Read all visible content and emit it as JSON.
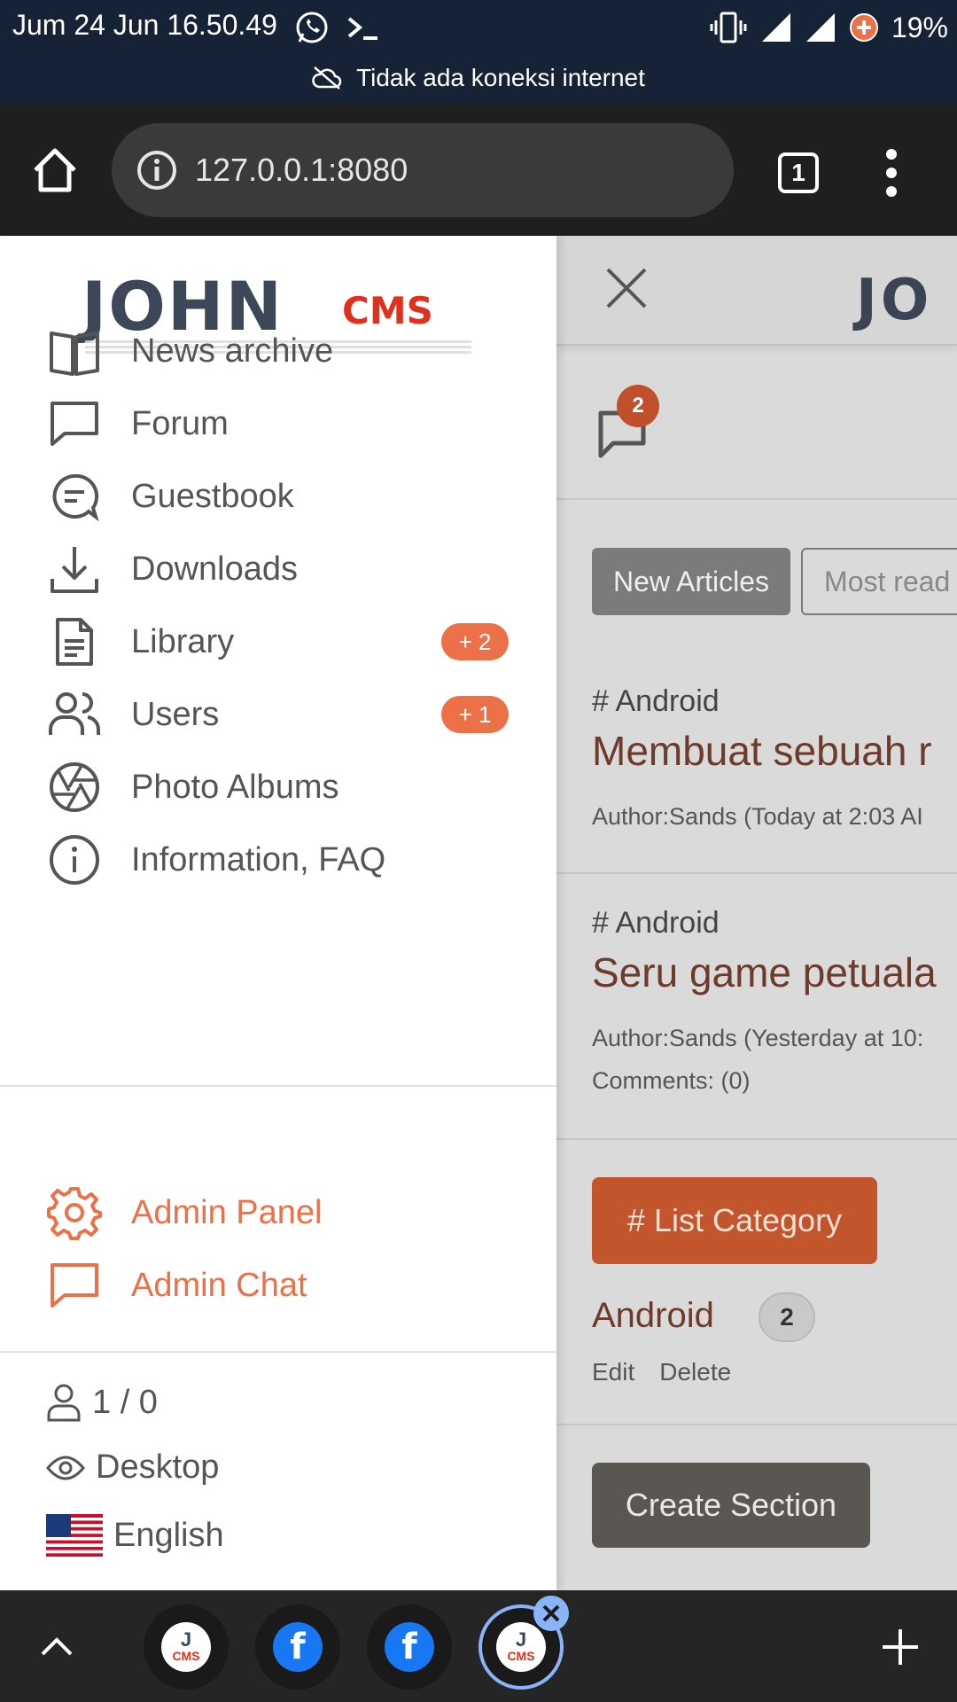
{
  "status_bar": {
    "time": "Jum 24 Jun 16.50.49",
    "battery": "19%",
    "offline_message": "Tidak ada koneksi internet"
  },
  "browser": {
    "url": "127.0.0.1:8080",
    "tab_count": "1"
  },
  "drawer": {
    "logo": {
      "john": "JOHN",
      "cms": "CMS"
    },
    "nav_items": [
      {
        "label": "News archive",
        "icon": "book-icon"
      },
      {
        "label": "Forum",
        "icon": "chat-icon"
      },
      {
        "label": "Guestbook",
        "icon": "guestbook-icon"
      },
      {
        "label": "Downloads",
        "icon": "download-icon"
      },
      {
        "label": "Library",
        "icon": "document-icon",
        "badge": "+ 2"
      },
      {
        "label": "Users",
        "icon": "users-icon",
        "badge": "+ 1"
      },
      {
        "label": "Photo Albums",
        "icon": "aperture-icon"
      },
      {
        "label": "Information, FAQ",
        "icon": "info-icon"
      }
    ],
    "admin_items": [
      {
        "label": "Admin Panel",
        "icon": "gear-icon"
      },
      {
        "label": "Admin Chat",
        "icon": "chat-icon"
      }
    ],
    "footer": {
      "online": "1 / 0",
      "version": "Desktop",
      "language": "English"
    }
  },
  "main": {
    "logo_partial": "JO",
    "chat_badge": "2",
    "tabs": [
      {
        "label": "New Articles",
        "active": true
      },
      {
        "label": "Most read",
        "active": false
      }
    ],
    "articles": [
      {
        "tag": "# Android",
        "title": "Membuat sebuah r",
        "meta": "Author:Sands (Today at 2:03 AI"
      },
      {
        "tag": "# Android",
        "title": "Seru game petuala",
        "meta": "Author:Sands (Yesterday at 10:",
        "comments": "Comments: (0)"
      }
    ],
    "list_category_label": "# List Category",
    "category": {
      "name": "Android",
      "count": "2",
      "edit": "Edit",
      "delete": "Delete"
    },
    "create_section_label": "Create Section"
  },
  "colors": {
    "accent": "#ec7048",
    "admin": "#ec7048",
    "status_bar": "#162235",
    "browser_bar": "#1f1f1f"
  }
}
